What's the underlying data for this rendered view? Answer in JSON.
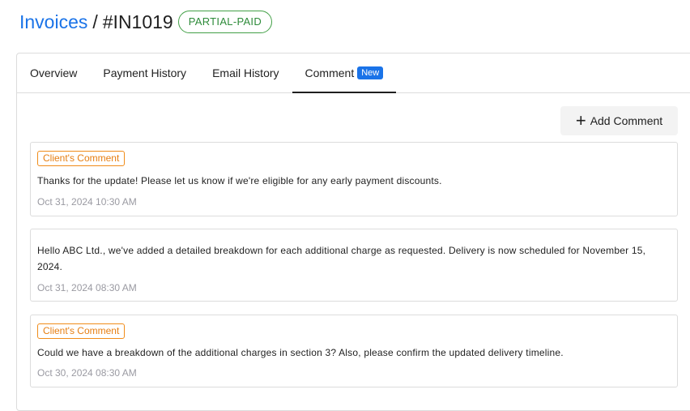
{
  "breadcrumb": {
    "link": "Invoices",
    "separator": "/",
    "invoice_id": "#IN1019",
    "status": "PARTIAL-PAID"
  },
  "tabs": [
    {
      "label": "Overview"
    },
    {
      "label": "Payment History"
    },
    {
      "label": "Email History"
    },
    {
      "label": "Comment",
      "badge": "New",
      "active": true
    }
  ],
  "actions": {
    "add_comment_label": "Add Comment",
    "add_icon": "plus-icon"
  },
  "comments": [
    {
      "tag": "Client's Comment",
      "text": "Thanks for the update! Please let us know if we're eligible for any early payment discounts.",
      "time": "Oct 31, 2024 10:30 AM"
    },
    {
      "tag": "",
      "text": "Hello ABC Ltd., we've added a detailed breakdown for each additional charge as requested. Delivery is now scheduled for November 15, 2024.",
      "time": "Oct 31, 2024 08:30 AM"
    },
    {
      "tag": "Client's Comment",
      "text": "Could we have a breakdown of the additional charges in section 3? Also, please confirm the updated delivery timeline.",
      "time": "Oct 30, 2024 08:30 AM"
    }
  ],
  "colors": {
    "link": "#1a73e8",
    "status": "#43a047",
    "client_tag": "#f08c1a",
    "tab_badge": "#1a73e8"
  }
}
